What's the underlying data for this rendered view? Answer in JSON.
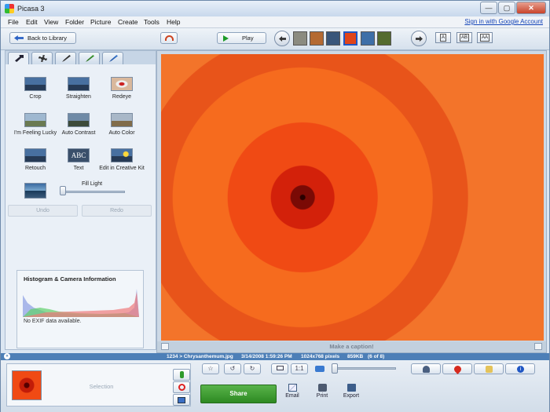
{
  "window": {
    "title": "Picasa 3",
    "buttons": [
      "—",
      "▢",
      "✕"
    ]
  },
  "menu": {
    "items": [
      "File",
      "Edit",
      "View",
      "Folder",
      "Picture",
      "Create",
      "Tools",
      "Help"
    ],
    "signin": "Sign in with Google Account"
  },
  "toolbar": {
    "back_label": "Back to Library",
    "play_label": "Play",
    "caption_modes": [
      "A",
      "AB",
      "AA"
    ]
  },
  "filmstrip": {
    "thumb_colors": [
      "#8b8b80",
      "#b46a32",
      "#39567a",
      "#e0441a",
      "#3d6fa8",
      "#546b2e"
    ]
  },
  "left_panel": {
    "tools": [
      {
        "label": "Crop"
      },
      {
        "label": "Straighten"
      },
      {
        "label": "Redeye"
      },
      {
        "label": "I'm Feeling Lucky"
      },
      {
        "label": "Auto Contrast"
      },
      {
        "label": "Auto Color"
      },
      {
        "label": "Retouch"
      },
      {
        "label": "Text",
        "img_text": "ABC"
      },
      {
        "label": "Edit in Creative Kit"
      }
    ],
    "fill_light_label": "Fill Light",
    "fill_light_value": 0,
    "undo_label": "Undo",
    "redo_label": "Redo",
    "histogram": {
      "title": "Histogram & Camera Information",
      "note": "No EXIF data available."
    }
  },
  "photo": {
    "caption_placeholder": "Make a caption!"
  },
  "status": {
    "path": "1234 > Chrysanthemum.jpg",
    "date": "3/14/2008 1:59:26 PM",
    "dimensions": "1024x768 pixels",
    "size": "859KB",
    "position": "(6 of 8)"
  },
  "tray": {
    "selection_label": "Selection",
    "share_label": "Share",
    "actions": [
      "Email",
      "Print",
      "Export"
    ]
  },
  "colors": {
    "accent": "#4d7fb7",
    "share": "#3d9a30",
    "link": "#1545b8"
  }
}
